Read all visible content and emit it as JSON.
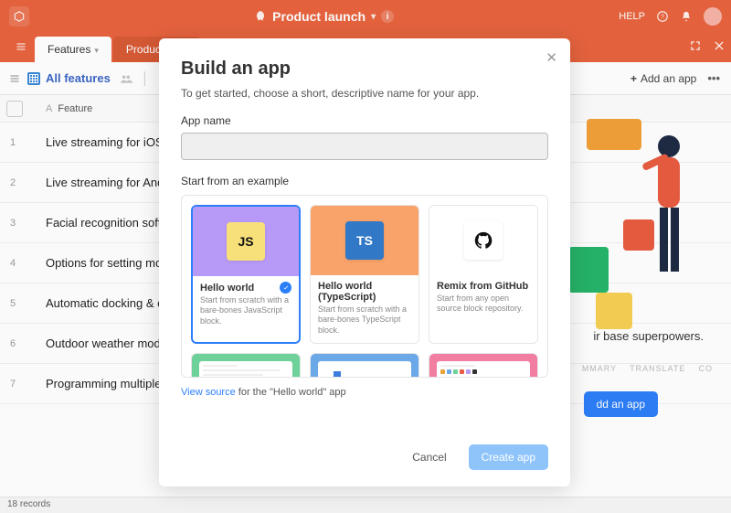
{
  "header": {
    "workspace_title": "Product launch",
    "help_label": "HELP"
  },
  "tabs": {
    "active": "Features",
    "inactive": "Product th…"
  },
  "viewbar": {
    "view_name": "All features",
    "add_app_label": "Add an app"
  },
  "table": {
    "column_label": "Feature",
    "rows": [
      "Live streaming for iOS devi",
      "Live streaming for Android",
      "Facial recognition software",
      "Options for setting mobile a",
      "Automatic docking & charg",
      "Outdoor weather mode pro",
      "Programming multiple Porc"
    ],
    "record_count": "18 records"
  },
  "right_panel": {
    "tagline": "ir base superpowers.",
    "tabs": [
      "MMARY",
      "TRANSLATE",
      "CO"
    ],
    "cta": "dd an app"
  },
  "modal": {
    "title": "Build an app",
    "subtitle": "To get started, choose a short, descriptive name for your app.",
    "name_label": "App name",
    "name_value": "",
    "examples_label": "Start from an example",
    "examples": [
      {
        "title": "Hello world",
        "desc": "Start from scratch with a bare-bones JavaScript block.",
        "badge": "JS",
        "bg": "#b79af7",
        "badge_bg": "#f7e07a",
        "selected": true
      },
      {
        "title": "Hello world (TypeScript)",
        "desc": "Start from scratch with a bare-bones TypeScript block.",
        "badge": "TS",
        "bg": "#f9a36b",
        "badge_bg": "#3178c6",
        "badge_color": "#fff",
        "selected": false
      },
      {
        "title": "Remix from GitHub",
        "desc": "Start from any open source block repository.",
        "badge": "GH",
        "bg": "#ffffff",
        "selected": false
      }
    ],
    "source_prefix": "View source",
    "source_suffix": " for the \"Hello world\" app",
    "cancel_label": "Cancel",
    "create_label": "Create app"
  }
}
